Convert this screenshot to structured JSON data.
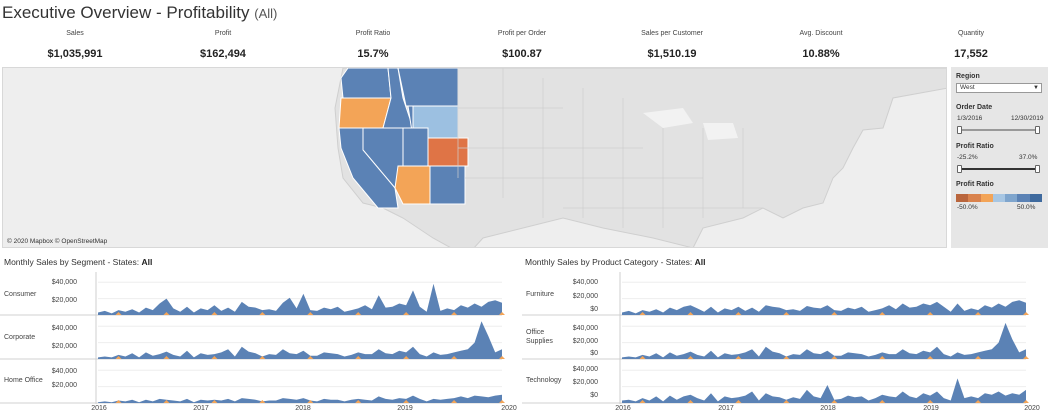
{
  "title": {
    "main": "Executive Overview - Profitability",
    "filter": "(All)"
  },
  "kpis": [
    {
      "label": "Sales",
      "value": "$1,035,991"
    },
    {
      "label": "Profit",
      "value": "$162,494"
    },
    {
      "label": "Profit Ratio",
      "value": "15.7%"
    },
    {
      "label": "Profit per Order",
      "value": "$100.87"
    },
    {
      "label": "Sales per Customer",
      "value": "$1,510.19"
    },
    {
      "label": "Avg. Discount",
      "value": "10.88%"
    },
    {
      "label": "Quantity",
      "value": "17,552"
    }
  ],
  "map": {
    "credit": "© 2020 Mapbox © OpenStreetMap"
  },
  "filters": {
    "region": {
      "label": "Region",
      "value": "West"
    },
    "order_date": {
      "label": "Order Date",
      "start": "1/3/2016",
      "end": "12/30/2019"
    },
    "profit_ratio_filter": {
      "label": "Profit Ratio",
      "min": "-25.2%",
      "max": "37.0%"
    },
    "profit_ratio_legend": {
      "label": "Profit Ratio",
      "min": "-50.0%",
      "max": "50.0%"
    }
  },
  "colors": {
    "blue": "#5b82b5",
    "light_blue": "#9cc0e1",
    "orange": "#f3a457",
    "dark_orange": "#df7446",
    "legend": [
      "#b9653c",
      "#d9824d",
      "#f3a457",
      "#a7c6e3",
      "#7fa5cd",
      "#5b82b5",
      "#3f6a9e"
    ]
  },
  "segment_panel": {
    "title": "Monthly Sales by Segment - States:",
    "title_value": "All",
    "rows": [
      "Consumer",
      "Corporate",
      "Home Office"
    ],
    "y_ticks": [
      "$40,000",
      "$20,000"
    ],
    "x_ticks": [
      "2016",
      "2017",
      "2018",
      "2019",
      "2020"
    ]
  },
  "category_panel": {
    "title": "Monthly Sales by Product Category - States:",
    "title_value": "All",
    "rows": [
      "Furniture",
      "Office\nSupplies",
      "Technology"
    ],
    "y_ticks": [
      "$40,000",
      "$20,000",
      "$0"
    ],
    "x_ticks": [
      "2016",
      "2017",
      "2018",
      "2019",
      "2020"
    ]
  },
  "chart_data": {
    "type": "area",
    "x_label_ticks": [
      "2016",
      "2017",
      "2018",
      "2019",
      "2020"
    ],
    "ylim": [
      0,
      50000
    ],
    "segment": {
      "Consumer": [
        3000,
        5000,
        2000,
        6000,
        4000,
        7000,
        3000,
        9000,
        6000,
        14000,
        20000,
        8000,
        4000,
        10000,
        3000,
        8000,
        6000,
        12000,
        5000,
        9000,
        4000,
        16000,
        10000,
        9000,
        6000,
        7000,
        5000,
        15000,
        21000,
        8000,
        26000,
        6000,
        5000,
        9000,
        7000,
        10000,
        4000,
        6000,
        8000,
        12000,
        7000,
        24000,
        9000,
        10000,
        14000,
        12000,
        30000,
        10000,
        4000,
        38000,
        5000,
        8000,
        6000,
        12000,
        9000,
        14000,
        10000,
        16000,
        18000,
        15000
      ],
      "Corporate": [
        2000,
        3000,
        2000,
        5000,
        3000,
        7000,
        2000,
        8000,
        4000,
        6000,
        9000,
        5000,
        3000,
        10000,
        2000,
        7000,
        5000,
        6000,
        8000,
        12000,
        3000,
        15000,
        9000,
        7000,
        3000,
        6000,
        5000,
        12000,
        7000,
        6000,
        10000,
        4000,
        4000,
        8000,
        7000,
        6000,
        3000,
        5000,
        8000,
        6000,
        6000,
        12000,
        7000,
        6000,
        10000,
        8000,
        15000,
        6000,
        3000,
        8000,
        5000,
        6000,
        8000,
        10000,
        12000,
        20000,
        46000,
        28000,
        8000,
        12000
      ],
      "Home Office": [
        1000,
        2000,
        1000,
        3000,
        2000,
        4000,
        1000,
        4000,
        2000,
        5000,
        4000,
        3000,
        2000,
        5000,
        1000,
        4000,
        3000,
        4000,
        3000,
        5000,
        2000,
        6000,
        5000,
        4000,
        2000,
        3000,
        3000,
        6000,
        5000,
        4000,
        6000,
        3000,
        2000,
        5000,
        4000,
        4000,
        2000,
        4000,
        5000,
        4000,
        3000,
        8000,
        5000,
        4000,
        6000,
        5000,
        9000,
        5000,
        2000,
        5000,
        4000,
        5000,
        6000,
        8000,
        6000,
        9000,
        8000,
        7000,
        9000,
        10000
      ]
    },
    "category": {
      "Furniture": [
        3000,
        5000,
        2000,
        6000,
        4000,
        7000,
        3000,
        9000,
        6000,
        10000,
        12000,
        8000,
        4000,
        10000,
        3000,
        8000,
        6000,
        10000,
        5000,
        9000,
        4000,
        12000,
        10000,
        9000,
        6000,
        7000,
        5000,
        11000,
        9000,
        8000,
        12000,
        6000,
        5000,
        9000,
        7000,
        10000,
        4000,
        6000,
        8000,
        12000,
        7000,
        14000,
        9000,
        10000,
        14000,
        12000,
        16000,
        10000,
        4000,
        14000,
        5000,
        8000,
        6000,
        12000,
        9000,
        14000,
        10000,
        16000,
        18000,
        15000
      ],
      "Office Supplies": [
        2000,
        3000,
        2000,
        5000,
        3000,
        7000,
        2000,
        8000,
        4000,
        6000,
        9000,
        5000,
        3000,
        10000,
        2000,
        7000,
        5000,
        6000,
        8000,
        12000,
        3000,
        15000,
        9000,
        7000,
        3000,
        6000,
        5000,
        12000,
        7000,
        6000,
        10000,
        4000,
        4000,
        8000,
        7000,
        6000,
        3000,
        5000,
        8000,
        6000,
        6000,
        12000,
        7000,
        6000,
        10000,
        8000,
        15000,
        6000,
        3000,
        8000,
        5000,
        6000,
        8000,
        10000,
        12000,
        20000,
        44000,
        24000,
        8000,
        12000
      ],
      "Technology": [
        3000,
        4000,
        2000,
        6000,
        3000,
        8000,
        2000,
        9000,
        4000,
        8000,
        10000,
        6000,
        3000,
        12000,
        2000,
        8000,
        6000,
        7000,
        9000,
        14000,
        3000,
        12000,
        8000,
        7000,
        4000,
        7000,
        5000,
        16000,
        8000,
        6000,
        22000,
        4000,
        5000,
        9000,
        7000,
        8000,
        3000,
        6000,
        10000,
        8000,
        7000,
        14000,
        8000,
        6000,
        12000,
        9000,
        14000,
        6000,
        3000,
        30000,
        6000,
        8000,
        6000,
        12000,
        10000,
        14000,
        9000,
        12000,
        10000,
        16000
      ]
    }
  }
}
